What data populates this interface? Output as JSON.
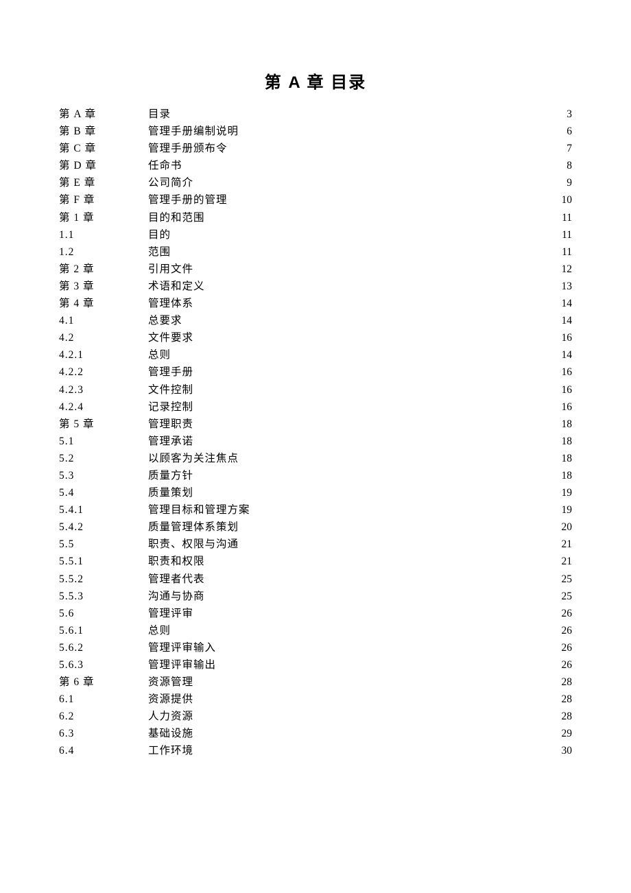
{
  "heading": "第 A 章  目录",
  "toc": [
    {
      "chapter": "第 A 章",
      "title": "目录",
      "page": "3"
    },
    {
      "chapter": "第 B 章",
      "title": "管理手册编制说明",
      "page": "6"
    },
    {
      "chapter": "第 C 章",
      "title": "管理手册颁布令",
      "page": "7"
    },
    {
      "chapter": "第 D 章",
      "title": "任命书",
      "page": "8"
    },
    {
      "chapter": "第 E 章",
      "title": "公司简介",
      "page": "9"
    },
    {
      "chapter": "第 F 章",
      "title": "管理手册的管理",
      "page": "10"
    },
    {
      "chapter": "第 1 章",
      "title": "目的和范围",
      "page": "11"
    },
    {
      "chapter": "1.1",
      "title": "目的",
      "page": "11"
    },
    {
      "chapter": "1.2",
      "title": "范围",
      "page": "11"
    },
    {
      "chapter": "第 2 章",
      "title": "引用文件",
      "page": "12"
    },
    {
      "chapter": "第 3 章",
      "title": "术语和定义",
      "page": "13"
    },
    {
      "chapter": "第 4 章",
      "title": "管理体系",
      "page": "14"
    },
    {
      "chapter": "4.1",
      "title": "总要求",
      "page": "14"
    },
    {
      "chapter": "4.2",
      "title": "文件要求",
      "page": "16"
    },
    {
      "chapter": "4.2.1",
      "title": "总则",
      "page": "14"
    },
    {
      "chapter": "4.2.2",
      "title": "管理手册",
      "page": "16"
    },
    {
      "chapter": "4.2.3",
      "title": "文件控制",
      "page": "16"
    },
    {
      "chapter": "4.2.4",
      "title": "记录控制",
      "page": "16"
    },
    {
      "chapter": "第 5 章",
      "title": "管理职责",
      "page": "18"
    },
    {
      "chapter": "5.1",
      "title": "管理承诺",
      "page": "18"
    },
    {
      "chapter": "5.2",
      "title": "以顾客为关注焦点",
      "page": "18"
    },
    {
      "chapter": "5.3",
      "title": "质量方针",
      "page": "18"
    },
    {
      "chapter": "5.4",
      "title": "质量策划",
      "page": "19"
    },
    {
      "chapter": "5.4.1",
      "title": "管理目标和管理方案",
      "page": "19"
    },
    {
      "chapter": "5.4.2",
      "title": "质量管理体系策划",
      "page": "20"
    },
    {
      "chapter": "5.5",
      "title": "职责、权限与沟通",
      "page": "21"
    },
    {
      "chapter": "5.5.1",
      "title": "职责和权限",
      "page": "21"
    },
    {
      "chapter": "5.5.2",
      "title": "管理者代表",
      "page": "25"
    },
    {
      "chapter": "5.5.3",
      "title": "沟通与协商",
      "page": "25"
    },
    {
      "chapter": "5.6",
      "title": "管理评审",
      "page": "26"
    },
    {
      "chapter": "5.6.1",
      "title": "总则",
      "page": "26"
    },
    {
      "chapter": "5.6.2",
      "title": "管理评审输入",
      "page": "26"
    },
    {
      "chapter": "5.6.3",
      "title": "管理评审输出",
      "page": "26"
    },
    {
      "chapter": "第 6 章",
      "title": "资源管理",
      "page": "28"
    },
    {
      "chapter": "6.1",
      "title": "资源提供",
      "page": "28"
    },
    {
      "chapter": "6.2",
      "title": "人力资源",
      "page": "28"
    },
    {
      "chapter": "6.3",
      "title": "基础设施",
      "page": "29"
    },
    {
      "chapter": "6.4",
      "title": "工作环境",
      "page": "30"
    }
  ]
}
